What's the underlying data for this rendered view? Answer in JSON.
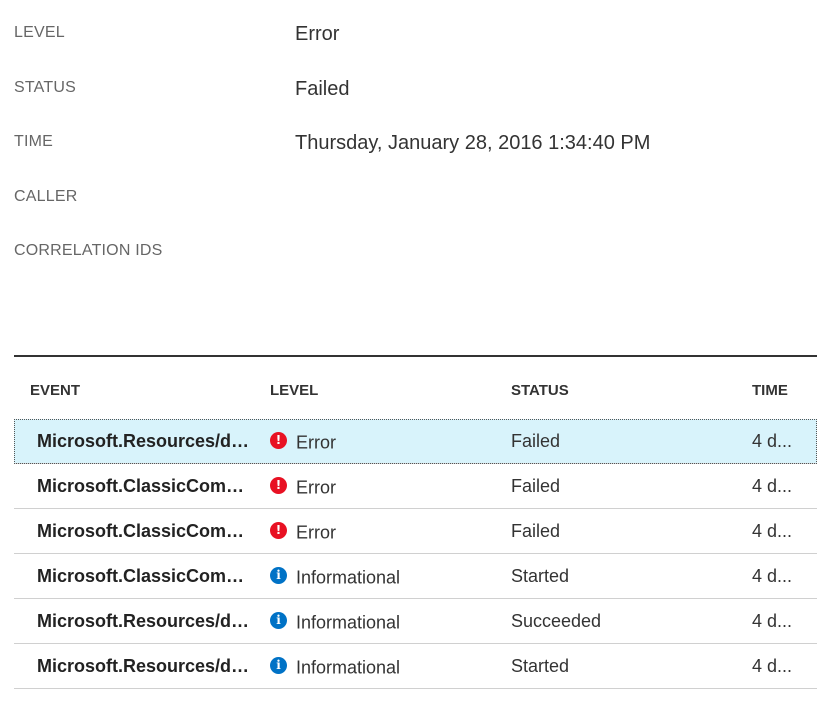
{
  "properties": [
    {
      "label": "LEVEL",
      "value": "Error"
    },
    {
      "label": "STATUS",
      "value": "Failed"
    },
    {
      "label": "TIME",
      "value": "Thursday, January 28, 2016 1:34:40 PM"
    },
    {
      "label": "CALLER",
      "value": ""
    },
    {
      "label": "CORRELATION IDS",
      "value": ""
    }
  ],
  "table": {
    "headers": {
      "event": "EVENT",
      "level": "LEVEL",
      "status": "STATUS",
      "time": "TIME"
    },
    "rows": [
      {
        "event": "Microsoft.Resources/de...",
        "level": "Error",
        "level_icon": "error-icon",
        "status": "Failed",
        "time": "4 d...",
        "selected": true
      },
      {
        "event": "Microsoft.ClassicComput...",
        "level": "Error",
        "level_icon": "error-icon",
        "status": "Failed",
        "time": "4 d...",
        "selected": false
      },
      {
        "event": "Microsoft.ClassicComput...",
        "level": "Error",
        "level_icon": "error-icon",
        "status": "Failed",
        "time": "4 d...",
        "selected": false
      },
      {
        "event": "Microsoft.ClassicComput...",
        "level": "Informational",
        "level_icon": "info-icon",
        "status": "Started",
        "time": "4 d...",
        "selected": false
      },
      {
        "event": "Microsoft.Resources/de...",
        "level": "Informational",
        "level_icon": "info-icon",
        "status": "Succeeded",
        "time": "4 d...",
        "selected": false
      },
      {
        "event": "Microsoft.Resources/de...",
        "level": "Informational",
        "level_icon": "info-icon",
        "status": "Started",
        "time": "4 d...",
        "selected": false
      }
    ]
  },
  "colors": {
    "error": "#e81123",
    "info": "#0072c6",
    "selected_row": "#d8f3fb"
  }
}
